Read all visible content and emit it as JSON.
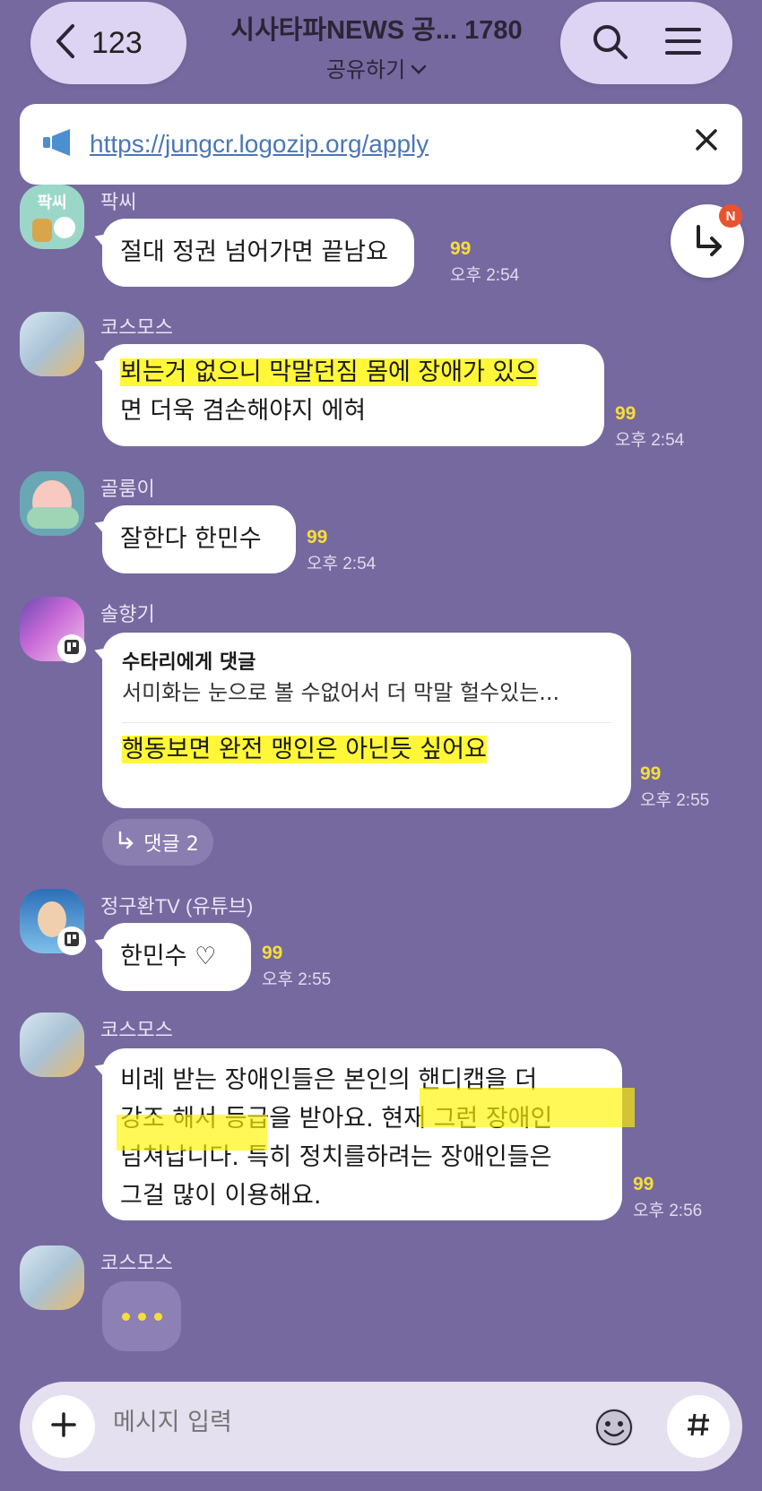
{
  "header": {
    "back_count": "123",
    "title": "시사타파NEWS 공... 1780",
    "subtitle": "공유하기"
  },
  "notice": {
    "url": "https://jungcr.logozip.org/apply"
  },
  "jump_badge": "N",
  "messages": [
    {
      "sender": "팍씨",
      "avatar_text": "팍씨",
      "lines": [
        "절대 정권 넘어가면 끝남요"
      ],
      "unread": "99",
      "time": "오후 2:54"
    },
    {
      "sender": "코스모스",
      "lines": [
        "뵈는거 없으니 막말던짐 몸에 장애가 있으",
        "면 더욱 겸손해야지 에혀"
      ],
      "unread": "99",
      "time": "오후 2:54"
    },
    {
      "sender": "골룸이",
      "lines": [
        "잘한다 한민수"
      ],
      "unread": "99",
      "time": "오후 2:54"
    },
    {
      "sender": "솔향기",
      "reply_to": "수타리에게 댓글",
      "quote": "서미화는 눈으로 볼 수없어서 더 막말 헐수있는...",
      "lines": [
        "행동보면 완전 맹인은 아닌듯 싶어요"
      ],
      "unread": "99",
      "time": "오후 2:55",
      "replies": "댓글 2"
    },
    {
      "sender": "정구환TV (유튜브)",
      "lines": [
        "한민수 ♡"
      ],
      "unread": "99",
      "time": "오후 2:55"
    },
    {
      "sender": "코스모스",
      "lines": [
        "비례 받는 장애인들은 본인의 핸디캡을 더",
        "강조 해서 등급을 받아요. 현재 그런 장애인",
        "넘쳐납니다. 특히 정치를하려는 장애인들은",
        "그걸 많이 이용해요."
      ],
      "unread": "99",
      "time": "오후 2:56"
    },
    {
      "sender": "코스모스"
    }
  ],
  "input": {
    "placeholder": "메시지 입력"
  },
  "colors": {
    "background": "#76699f",
    "header_pill": "#dcd4f2",
    "unread": "#f6de3a",
    "highlight": "#fff500",
    "link": "#4b77b5"
  }
}
